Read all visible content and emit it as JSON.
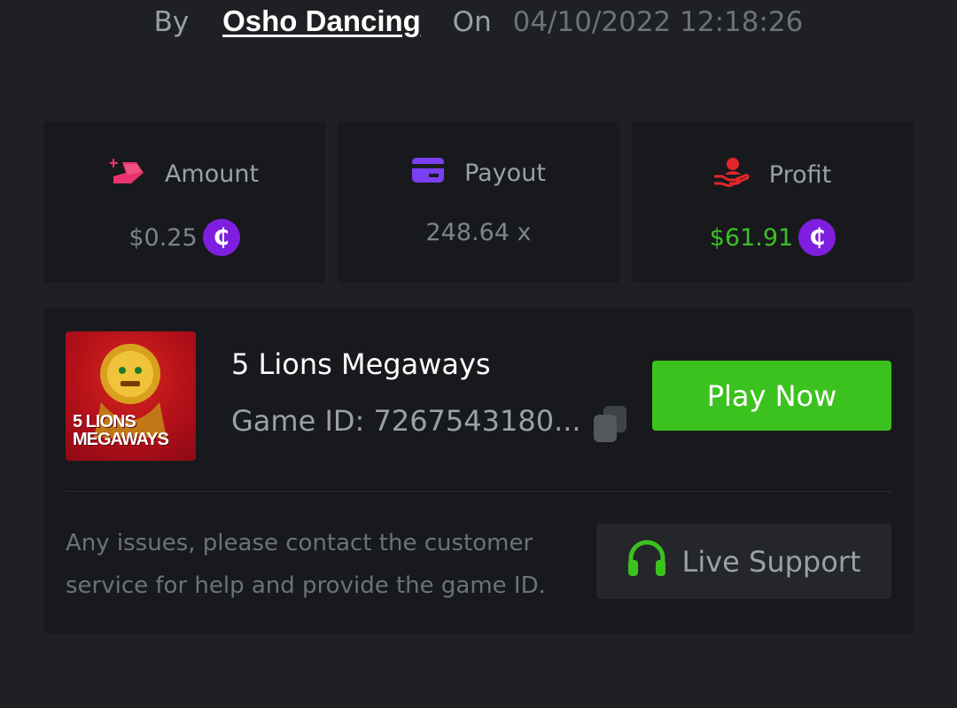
{
  "header": {
    "by_label": "By",
    "username": "Osho Dancing",
    "on_label": "On",
    "datetime": "04/10/2022 12:18:26"
  },
  "stats": {
    "amount": {
      "label": "Amount",
      "value": "$0.25",
      "icon": "bet-amount-icon",
      "icon_color": "#e8336e"
    },
    "payout": {
      "label": "Payout",
      "value": "248.64 x",
      "icon": "card-icon",
      "icon_color": "#7b3ff2"
    },
    "profit": {
      "label": "Profit",
      "value": "$61.91",
      "icon": "hand-profit-icon",
      "icon_color": "#e3262b",
      "value_color": "#3cc026"
    }
  },
  "currency": {
    "symbol": "₵",
    "color": "#7e1fe0"
  },
  "game": {
    "thumbnail_text_line1": "5 LIONS",
    "thumbnail_text_line2": "MEGAWAYS",
    "title": "5 Lions Megaways",
    "id_text": "Game ID: 7267543180...",
    "play_label": "Play Now"
  },
  "support": {
    "notice": "Any issues, please contact the customer service for help and provide the game ID.",
    "button_label": "Live Support"
  },
  "colors": {
    "background": "#1f2024",
    "card": "#18191c",
    "accent_green": "#3cc21f"
  }
}
